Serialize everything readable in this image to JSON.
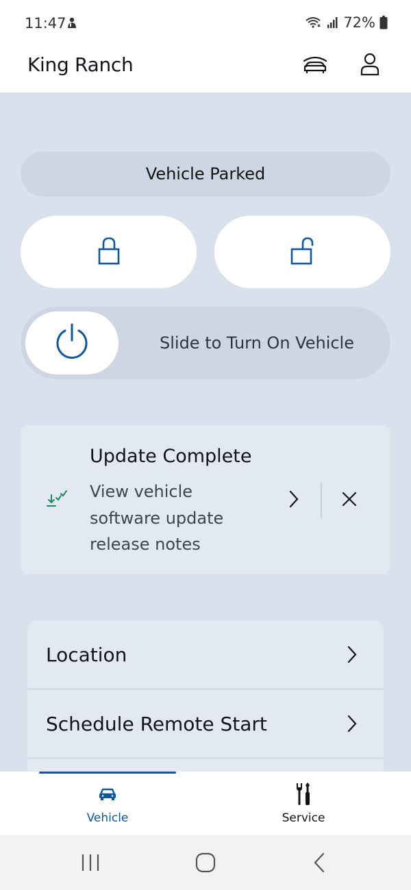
{
  "status_bar": {
    "time": "11:47",
    "battery_percent": "72%",
    "icons": [
      "notification-icon",
      "wifi-call-icon",
      "signal-icon",
      "battery-icon"
    ]
  },
  "app_bar": {
    "title": "King Ranch",
    "icons": [
      "garage-icon",
      "account-icon"
    ]
  },
  "vehicle_status": {
    "label": "Vehicle Parked"
  },
  "controls": {
    "lock_icon": "lock-icon",
    "unlock_icon": "unlock-icon",
    "slider_label": "Slide to Turn On Vehicle",
    "slider_icon": "power-icon"
  },
  "update_card": {
    "title": "Update Complete",
    "body_lines": [
      "View vehicle",
      "software update",
      "release notes"
    ],
    "icon": "download-check-icon"
  },
  "menu": {
    "items": [
      {
        "label": "Location"
      },
      {
        "label": "Schedule Remote Start"
      }
    ]
  },
  "bottom_nav": {
    "tabs": [
      {
        "label": "Vehicle",
        "icon": "car-icon",
        "selected": true
      },
      {
        "label": "Service",
        "icon": "tools-icon",
        "selected": false
      }
    ]
  },
  "colors": {
    "accent": "#0b57a4",
    "background": "#d9e1ec",
    "card": "#e3e9f2",
    "pill": "#cdd6e2",
    "update_icon": "#1a8a5a"
  }
}
